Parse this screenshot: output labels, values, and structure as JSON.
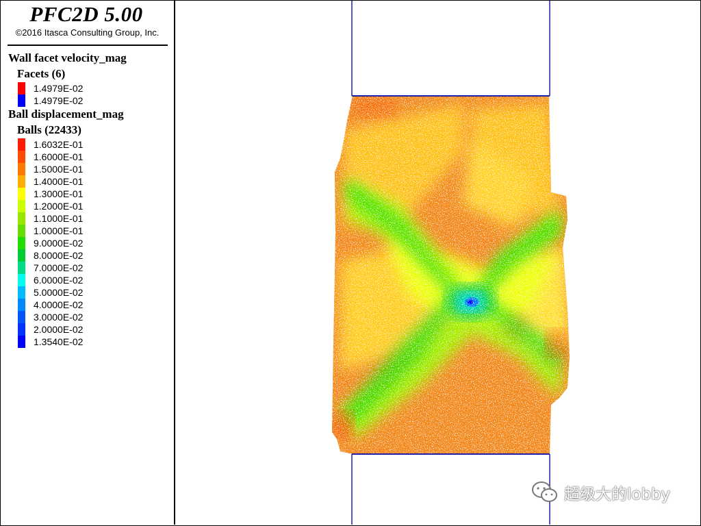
{
  "app": {
    "title": "PFC2D 5.00",
    "copyright": "©2016 Itasca Consulting Group, Inc."
  },
  "legend": {
    "wall_section": {
      "title": "Wall facet velocity_mag",
      "subtitle": "Facets (6)",
      "items": [
        {
          "label": "1.4979E-02",
          "color": "#ff0000"
        },
        {
          "label": "1.4979E-02",
          "color": "#0000ff"
        }
      ]
    },
    "ball_section": {
      "title": "Ball displacement_mag",
      "subtitle": "Balls (22433)",
      "items": [
        {
          "label": "1.6032E-01",
          "color": "#ff1a00"
        },
        {
          "label": "1.6000E-01",
          "color": "#ff4a00"
        },
        {
          "label": "1.5000E-01",
          "color": "#ff7a00"
        },
        {
          "label": "1.4000E-01",
          "color": "#ffad00"
        },
        {
          "label": "1.3000E-01",
          "color": "#ffff00"
        },
        {
          "label": "1.2000E-01",
          "color": "#ccff00"
        },
        {
          "label": "1.1000E-01",
          "color": "#99e600"
        },
        {
          "label": "1.0000E-01",
          "color": "#66dd00"
        },
        {
          "label": "9.0000E-02",
          "color": "#22dd00"
        },
        {
          "label": "8.0000E-02",
          "color": "#00cc33"
        },
        {
          "label": "7.0000E-02",
          "color": "#00dd88"
        },
        {
          "label": "6.0000E-02",
          "color": "#00ffee"
        },
        {
          "label": "5.0000E-02",
          "color": "#00bbff"
        },
        {
          "label": "4.0000E-02",
          "color": "#0088ff"
        },
        {
          "label": "3.0000E-02",
          "color": "#0055ff"
        },
        {
          "label": "2.0000E-02",
          "color": "#0033ff"
        },
        {
          "label": "1.3540E-02",
          "color": "#0000ff"
        }
      ]
    }
  },
  "model": {
    "wall_color": "#1f1fa8",
    "sample_base_color": "#f28a1f"
  },
  "watermark": {
    "text": "超级大的lobby",
    "icon": "wechat-icon"
  }
}
